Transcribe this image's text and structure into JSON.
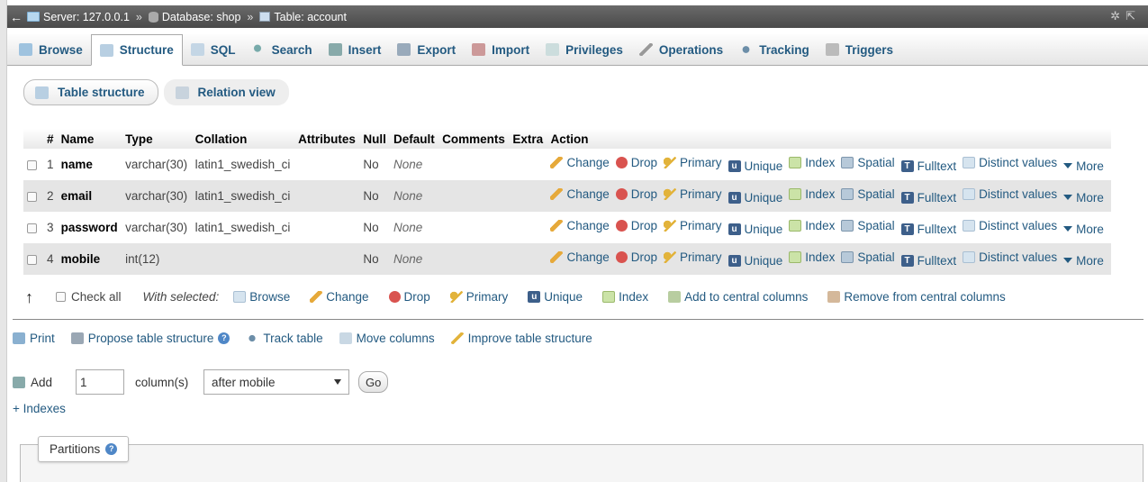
{
  "breadcrumb": {
    "server": "Server: 127.0.0.1",
    "database": "Database: shop",
    "table": "Table: account",
    "separator": "»"
  },
  "tabs": [
    {
      "label": "Browse",
      "icon": "browse-icon"
    },
    {
      "label": "Structure",
      "icon": "structure-icon",
      "active": true
    },
    {
      "label": "SQL",
      "icon": "sql-icon"
    },
    {
      "label": "Search",
      "icon": "search-icon"
    },
    {
      "label": "Insert",
      "icon": "insert-icon"
    },
    {
      "label": "Export",
      "icon": "export-icon"
    },
    {
      "label": "Import",
      "icon": "import-icon"
    },
    {
      "label": "Privileges",
      "icon": "privileges-icon"
    },
    {
      "label": "Operations",
      "icon": "operations-icon"
    },
    {
      "label": "Tracking",
      "icon": "tracking-icon"
    },
    {
      "label": "Triggers",
      "icon": "triggers-icon"
    }
  ],
  "subtabs": {
    "table_structure": "Table structure",
    "relation_view": "Relation view"
  },
  "table": {
    "headers": [
      "#",
      "Name",
      "Type",
      "Collation",
      "Attributes",
      "Null",
      "Default",
      "Comments",
      "Extra",
      "Action"
    ],
    "rows": [
      {
        "num": "1",
        "name": "name",
        "type": "varchar(30)",
        "collation": "latin1_swedish_ci",
        "attributes": "",
        "null": "No",
        "default": "None",
        "comments": "",
        "extra": ""
      },
      {
        "num": "2",
        "name": "email",
        "type": "varchar(30)",
        "collation": "latin1_swedish_ci",
        "attributes": "",
        "null": "No",
        "default": "None",
        "comments": "",
        "extra": ""
      },
      {
        "num": "3",
        "name": "password",
        "type": "varchar(30)",
        "collation": "latin1_swedish_ci",
        "attributes": "",
        "null": "No",
        "default": "None",
        "comments": "",
        "extra": ""
      },
      {
        "num": "4",
        "name": "mobile",
        "type": "int(12)",
        "collation": "",
        "attributes": "",
        "null": "No",
        "default": "None",
        "comments": "",
        "extra": ""
      }
    ],
    "actions": {
      "change": "Change",
      "drop": "Drop",
      "primary": "Primary",
      "unique": "Unique",
      "index": "Index",
      "spatial": "Spatial",
      "fulltext": "Fulltext",
      "distinct": "Distinct values",
      "more": "More"
    }
  },
  "bulk": {
    "check_all": "Check all",
    "with_selected": "With selected:",
    "browse": "Browse",
    "change": "Change",
    "drop": "Drop",
    "primary": "Primary",
    "unique": "Unique",
    "index": "Index",
    "add_central": "Add to central columns",
    "remove_central": "Remove from central columns"
  },
  "tools": {
    "print": "Print",
    "propose": "Propose table structure",
    "track": "Track table",
    "move": "Move columns",
    "improve": "Improve table structure"
  },
  "add_column": {
    "label": "Add",
    "count": "1",
    "unit": "column(s)",
    "position": "after mobile",
    "go": "Go"
  },
  "indexes_link": "+ Indexes",
  "partitions_label": "Partitions"
}
